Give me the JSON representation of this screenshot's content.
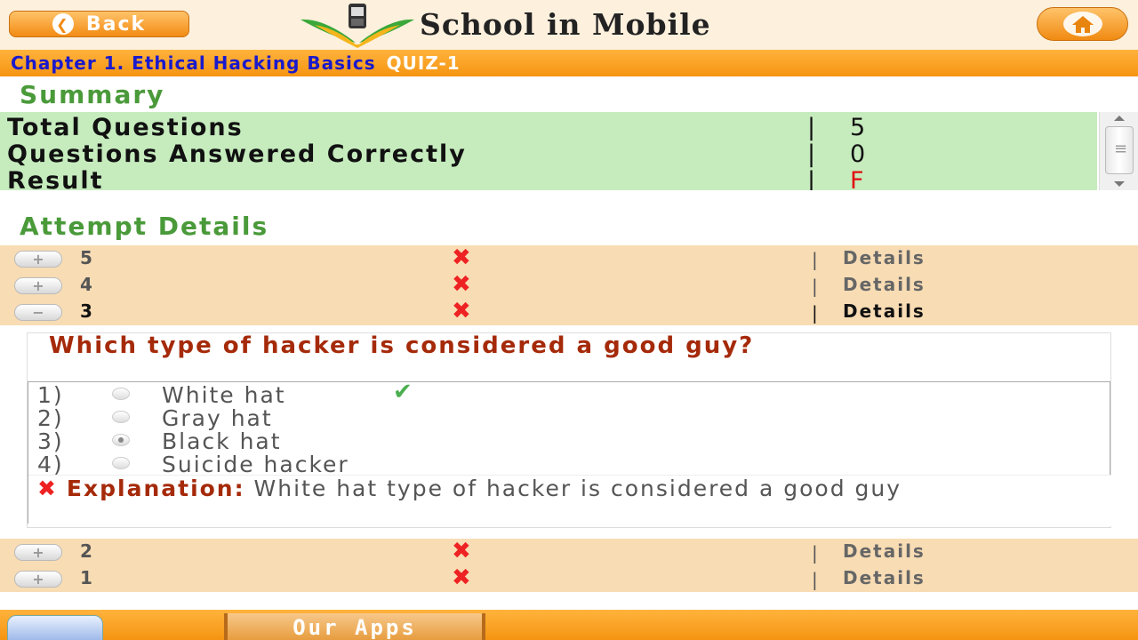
{
  "header": {
    "back_label": "Back",
    "app_title": "School in Mobile"
  },
  "chapter": {
    "title": "Chapter 1. Ethical Hacking Basics",
    "quiz": "QUIZ-1"
  },
  "summary": {
    "heading": "Summary",
    "rows": [
      {
        "label": "Total Questions",
        "sep": "|",
        "value": "5"
      },
      {
        "label": "Questions Answered Correctly",
        "sep": "|",
        "value": "0"
      },
      {
        "label": "Result",
        "sep": "|",
        "value": "F"
      }
    ]
  },
  "attempts": {
    "heading": "Attempt Details",
    "rows": [
      {
        "num": "5",
        "sep": "|",
        "details": "Details",
        "toggle": "+"
      },
      {
        "num": "4",
        "sep": "|",
        "details": "Details",
        "toggle": "+"
      },
      {
        "num": "3",
        "sep": "|",
        "details": "Details",
        "toggle": "−"
      },
      {
        "num": "2",
        "sep": "|",
        "details": "Details",
        "toggle": "+"
      },
      {
        "num": "1",
        "sep": "|",
        "details": "Details",
        "toggle": "+"
      }
    ]
  },
  "question": {
    "text": "Which type of hacker is considered a good guy?",
    "options": [
      {
        "n": "1)",
        "text": "White hat"
      },
      {
        "n": "2)",
        "text": "Gray hat"
      },
      {
        "n": "3)",
        "text": " Black hat"
      },
      {
        "n": "4)",
        "text": "Suicide hacker"
      }
    ],
    "explanation_label": "Explanation:",
    "explanation": " White hat type of hacker is considered a good guy"
  },
  "footer": {
    "our_apps": "Our Apps"
  },
  "colors": {
    "accent": "#f59412",
    "summary_bg": "#c6ecbe",
    "attempt_bg": "#f8dcb4",
    "wrong": "#e22222",
    "correct": "#4caf50"
  }
}
